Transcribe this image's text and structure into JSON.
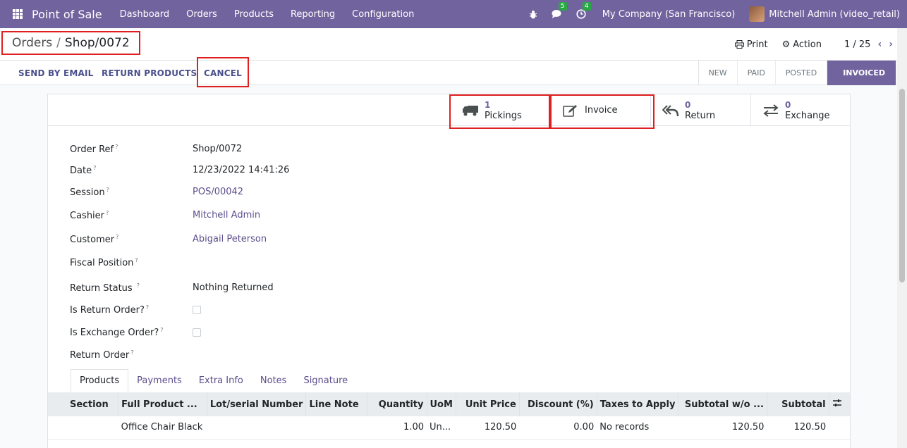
{
  "navbar": {
    "app_name": "Point of Sale",
    "menu": [
      "Dashboard",
      "Orders",
      "Products",
      "Reporting",
      "Configuration"
    ],
    "messages_badge": "5",
    "activities_badge": "4",
    "company": "My Company (San Francisco)",
    "user": "Mitchell Admin (video_retail)",
    "brand_color": "#71639e"
  },
  "control_panel": {
    "breadcrumb_parent": "Orders",
    "breadcrumb_separator": "/",
    "breadcrumb_current": "Shop/0072",
    "print_label": "Print",
    "action_label": "Action",
    "pager": "1 / 25"
  },
  "statusbar": {
    "buttons": [
      "SEND BY EMAIL",
      "RETURN PRODUCTS",
      "CANCEL"
    ],
    "stages": [
      "NEW",
      "PAID",
      "POSTED",
      "INVOICED"
    ],
    "active_stage": "INVOICED"
  },
  "smart_buttons": {
    "pickings": {
      "count": "1",
      "label": "Pickings"
    },
    "invoice": {
      "label": "Invoice"
    },
    "return": {
      "count": "0",
      "label": "Return"
    },
    "exchange": {
      "count": "0",
      "label": "Exchange"
    }
  },
  "fields": {
    "order_ref": {
      "label": "Order Ref",
      "value": "Shop/0072"
    },
    "date": {
      "label": "Date",
      "value": "12/23/2022 14:41:26"
    },
    "session": {
      "label": "Session",
      "value": "POS/00042"
    },
    "cashier": {
      "label": "Cashier",
      "value": "Mitchell Admin"
    },
    "customer": {
      "label": "Customer",
      "value": "Abigail Peterson"
    },
    "fiscal_position": {
      "label": "Fiscal Position",
      "value": ""
    },
    "return_status": {
      "label": "Return Status",
      "value": "Nothing Returned"
    },
    "is_return_order": {
      "label": "Is Return Order?"
    },
    "is_exchange_order": {
      "label": "Is Exchange Order?"
    },
    "return_order": {
      "label": "Return Order",
      "value": ""
    },
    "help_mark": "?"
  },
  "tabs": [
    "Products",
    "Payments",
    "Extra Info",
    "Notes",
    "Signature"
  ],
  "lines_table": {
    "headers": [
      "Section",
      "Full Product ...",
      "Lot/serial Number",
      "Line Note",
      "Quantity",
      "UoM",
      "Unit Price",
      "Discount (%)",
      "Taxes to Apply",
      "Subtotal w/o ...",
      "Subtotal"
    ],
    "rows": [
      [
        "",
        "Office Chair Black",
        "",
        "",
        "1.00",
        "Un...",
        "120.50",
        "0.00",
        "No records",
        "120.50",
        "120.50"
      ]
    ]
  }
}
